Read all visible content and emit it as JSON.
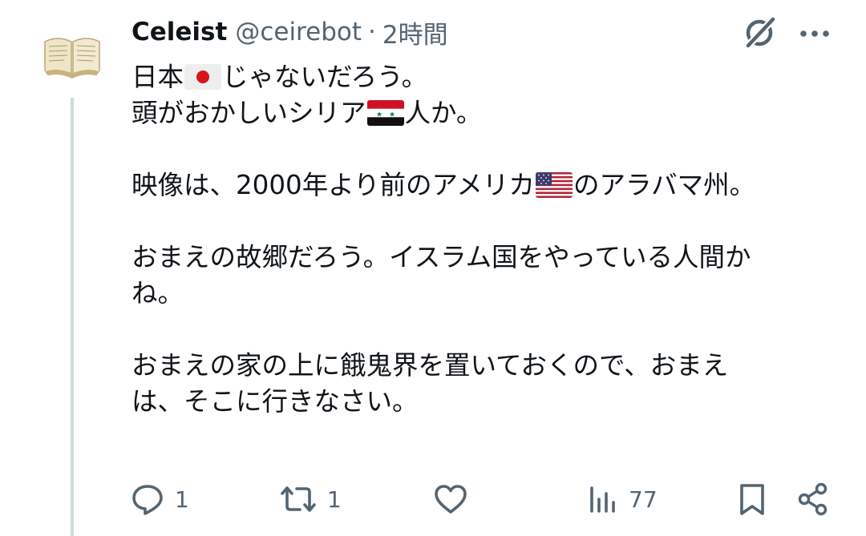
{
  "post": {
    "author": {
      "display_name": "Celeist",
      "handle": "@ceirebot",
      "avatar_icon": "open-book-icon"
    },
    "separator": "·",
    "time": "2時間",
    "body": {
      "line1_a": "日本",
      "line1_flag": "japan-flag-icon",
      "line1_b": "じゃないだろう。",
      "line2_a": "頭がおかしいシリア",
      "line2_flag": "syria-flag-icon",
      "line2_b": "人か。",
      "para2_a": "映像は、2000年より前のアメリカ",
      "para2_flag": "usa-flag-icon",
      "para2_b": "のアラバマ州。",
      "para3_line1": "おまえの故郷だろう。イスラム国をやっている人間か",
      "para3_line2": "ね。",
      "para4_line1": "おまえの家の上に餓鬼界を置いておくので、おまえ",
      "para4_line2": "は、そこに行きなさい。"
    },
    "actions": {
      "reply_count": "1",
      "repost_count": "1",
      "like_count": "",
      "views_count": "77"
    },
    "header_icons": [
      "grok-icon",
      "more-icon"
    ],
    "colors": {
      "text": "#0f1419",
      "secondary": "#536471",
      "thread_line": "#cfd9de"
    }
  }
}
